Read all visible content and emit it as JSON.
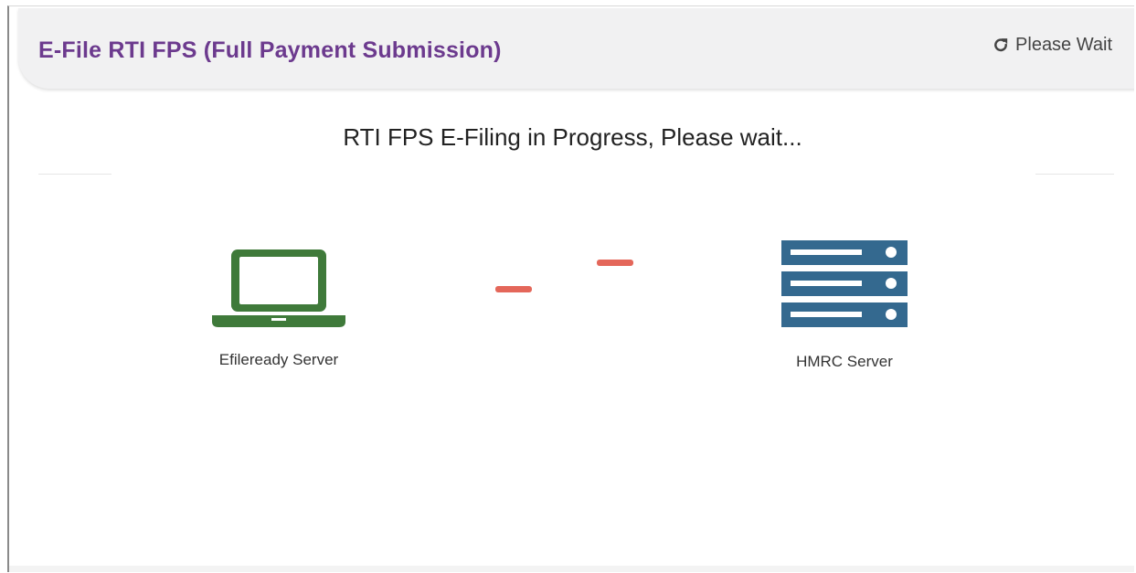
{
  "header": {
    "title": "E-File RTI FPS (Full Payment Submission)",
    "status_icon": "refresh-icon",
    "status_text": "Please Wait"
  },
  "main": {
    "progress_message": "RTI FPS E-Filing in Progress, Please wait..."
  },
  "transfer": {
    "source": {
      "icon": "laptop-icon",
      "label": "Efileready Server"
    },
    "destination": {
      "icon": "server-icon",
      "label": "HMRC Server"
    }
  },
  "colors": {
    "title": "#6c3a8e",
    "laptop": "#3f7a3a",
    "server": "#34698f",
    "transfer_dash": "#e4675a"
  }
}
